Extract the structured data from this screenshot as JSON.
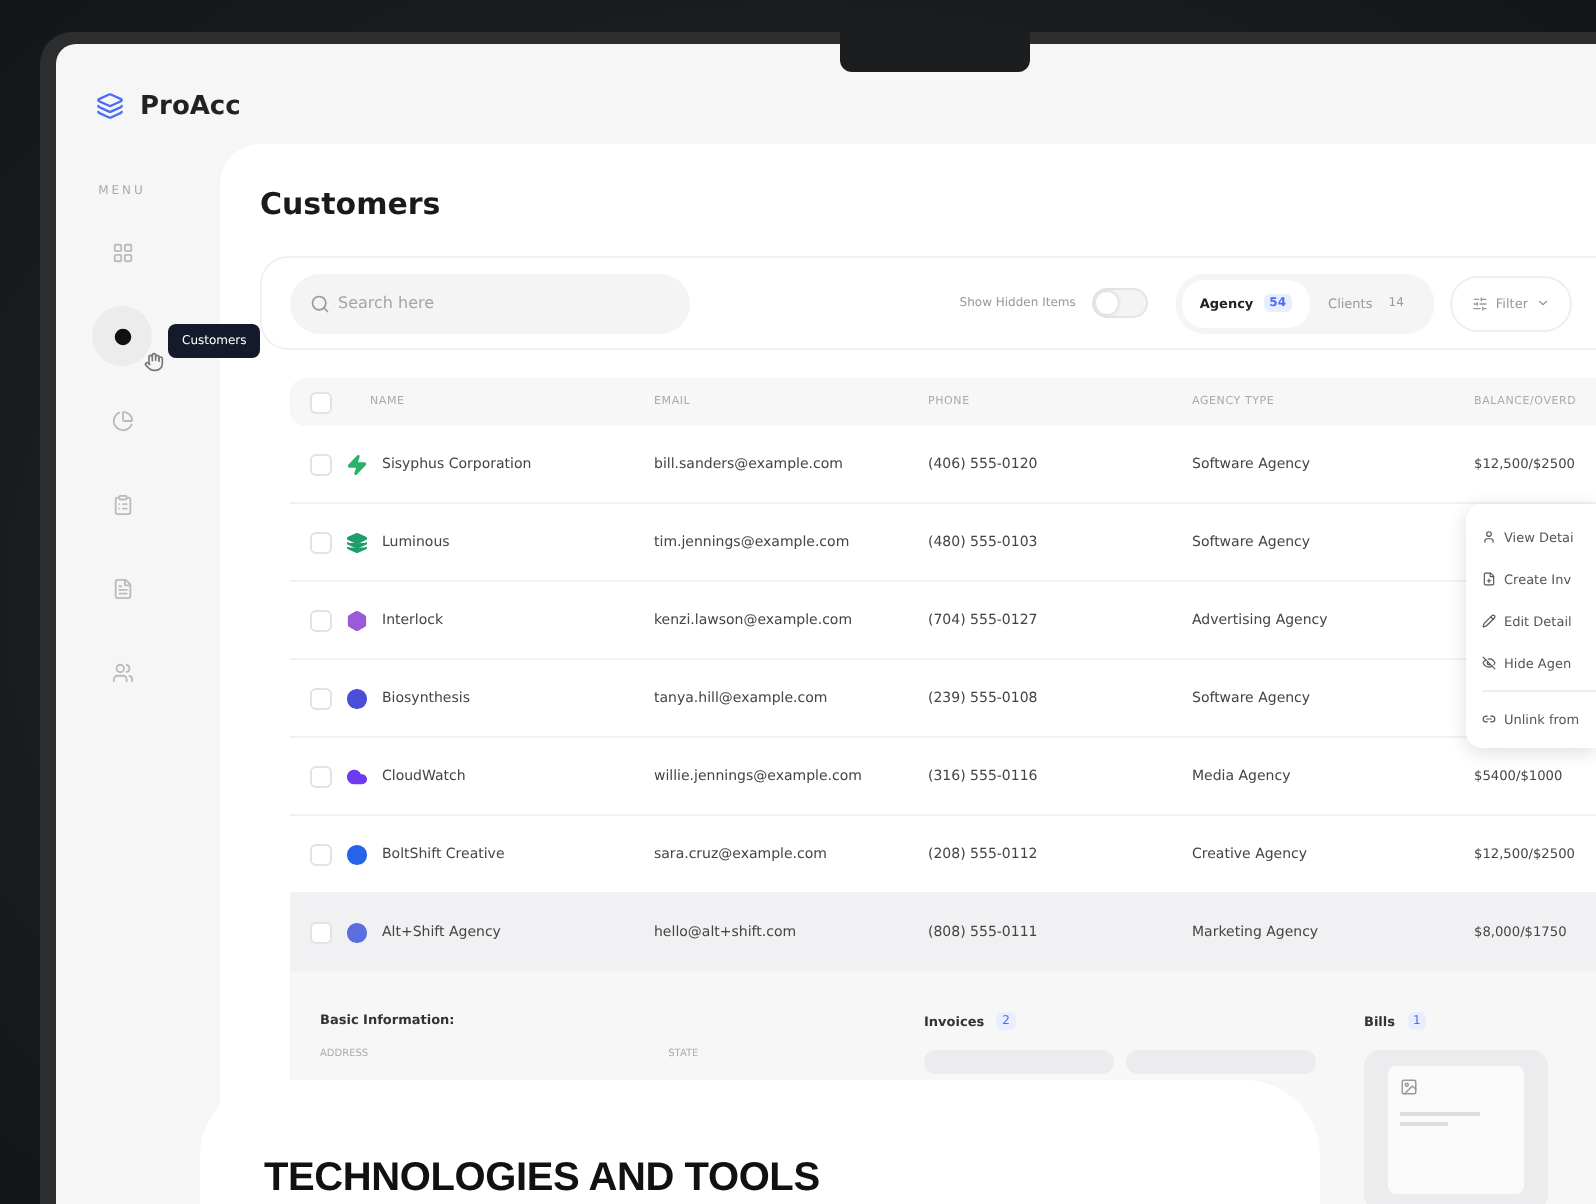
{
  "app": {
    "name": "ProAcc"
  },
  "sidebar": {
    "heading": "MENU",
    "items": [
      {
        "selected": false
      },
      {
        "selected": true
      },
      {
        "selected": false
      },
      {
        "selected": false
      },
      {
        "selected": false
      },
      {
        "selected": false
      }
    ],
    "tooltip": "Customers"
  },
  "page": {
    "title": "Customers"
  },
  "toolbar": {
    "search": {
      "placeholder": "Search here"
    },
    "toggle": {
      "label": "Show Hidden Items",
      "on": false
    },
    "segments": [
      {
        "label": "Agency",
        "count": "54",
        "selected": true
      },
      {
        "label": "Clients",
        "count": "14",
        "selected": false
      }
    ],
    "filter": {
      "label": "Filter"
    }
  },
  "table": {
    "select_all": {
      "checked": false
    },
    "columns": [
      "NAME",
      "EMAIL",
      "PHONE",
      "AGENCY TYPE",
      "BALANCE/OVERD"
    ],
    "rows": [
      {
        "name": "Sisyphus Corporation",
        "email": "bill.sanders@example.com",
        "phone": "(406) 555-0120",
        "agency_type": "Software Agency",
        "balance": "$12,500/$2500",
        "checked": false,
        "expanded": false,
        "color": "#27b36a"
      },
      {
        "name": "Luminous",
        "email": "tim.jennings@example.com",
        "phone": "(480) 555-0103",
        "agency_type": "Software Agency",
        "checked": false,
        "expanded": false,
        "color": "#1f9d6b"
      },
      {
        "name": "Interlock",
        "email": "kenzi.lawson@example.com",
        "phone": "(704) 555-0127",
        "agency_type": "Advertising Agency",
        "checked": false,
        "expanded": false,
        "color": "#9b5ad8"
      },
      {
        "name": "Biosynthesis",
        "email": "tanya.hill@example.com",
        "phone": "(239) 555-0108",
        "agency_type": "Software Agency",
        "checked": false,
        "expanded": false,
        "color": "#4b4ed8"
      },
      {
        "name": "CloudWatch",
        "email": "willie.jennings@example.com",
        "phone": "(316) 555-0116",
        "agency_type": "Media Agency",
        "balance": "$5400/$1000",
        "checked": false,
        "expanded": false,
        "color": "#6c3bf0"
      },
      {
        "name": "BoltShift Creative",
        "email": "sara.cruz@example.com",
        "phone": "(208) 555-0112",
        "agency_type": "Creative Agency",
        "balance": "$12,500/$2500",
        "checked": false,
        "expanded": false,
        "color": "#2563eb"
      },
      {
        "name": "Alt+Shift Agency",
        "email": "hello@alt+shift.com",
        "phone": "(808) 555-0111",
        "agency_type": "Marketing Agency",
        "balance": "$8,000/$1750",
        "checked": false,
        "expanded": true,
        "color": "#5a6ee0"
      }
    ]
  },
  "row_menu": {
    "items": [
      {
        "label": "View Detai"
      },
      {
        "label": "Create Inv"
      },
      {
        "label": "Edit Detail"
      },
      {
        "label": "Hide Agen"
      }
    ],
    "footer_items": [
      {
        "label": "Unlink from"
      }
    ]
  },
  "details": {
    "basic": {
      "title": "Basic Information:",
      "fields": [
        "ADDRESS",
        "STATE"
      ]
    },
    "invoices": {
      "title": "Invoices",
      "count": "2"
    },
    "bills": {
      "title": "Bills",
      "count": "1"
    }
  },
  "banner": {
    "text": "TECHNOLOGIES AND TOOLS"
  }
}
